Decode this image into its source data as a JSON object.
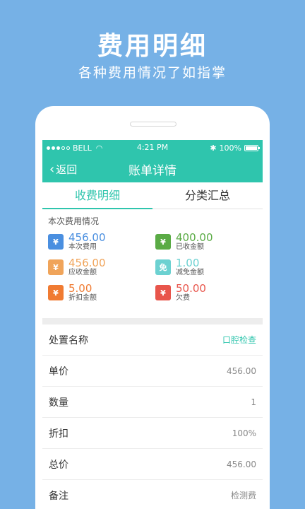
{
  "promo": {
    "title": "费用明细",
    "subtitle": "各种费用情况了如指掌"
  },
  "status_bar": {
    "carrier": "BELL",
    "time": "4:21 PM",
    "battery": "100%"
  },
  "nav": {
    "back_label": "返回",
    "title": "账单详情"
  },
  "tabs": [
    {
      "label": "收费明细",
      "active": true
    },
    {
      "label": "分类汇总",
      "active": false
    }
  ],
  "summary": {
    "title": "本次费用情况",
    "items": [
      {
        "value": "456.00",
        "label": "本次费用",
        "color": "#4a8fe0",
        "icon": "money-bag-icon",
        "glyph": "¥"
      },
      {
        "value": "400.00",
        "label": "已收金额",
        "color": "#5aab45",
        "icon": "payment-check-icon",
        "glyph": "¥"
      },
      {
        "value": "456.00",
        "label": "应收金额",
        "color": "#f0a45a",
        "icon": "house-yen-icon",
        "glyph": "¥"
      },
      {
        "value": "1.00",
        "label": "减免金额",
        "color": "#6cd1d1",
        "icon": "waiver-icon",
        "glyph": "免"
      },
      {
        "value": "5.00",
        "label": "折扣金额",
        "color": "#f07b32",
        "icon": "discount-icon",
        "glyph": "¥"
      },
      {
        "value": "50.00",
        "label": "欠费",
        "color": "#e8554b",
        "icon": "arrears-icon",
        "glyph": "¥"
      }
    ]
  },
  "details": [
    {
      "key": "处置名称",
      "value": "口腔检查",
      "accent": true
    },
    {
      "key": "单价",
      "value": "456.00"
    },
    {
      "key": "数量",
      "value": "1"
    },
    {
      "key": "折扣",
      "value": "100%"
    },
    {
      "key": "总价",
      "value": "456.00"
    },
    {
      "key": "备注",
      "value": "检测费"
    }
  ],
  "colors": {
    "accent": "#2fc5ad",
    "background": "#76b1e6"
  }
}
